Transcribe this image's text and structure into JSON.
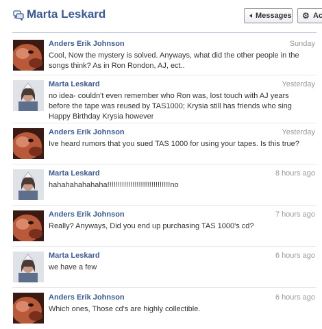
{
  "header": {
    "title": "Marta Leskard",
    "title_icon": "chat-bubbles-icon",
    "messages_button": "Messages",
    "actions_button": "Ac"
  },
  "colors": {
    "link_blue": "#3b5998",
    "timestamp_gray": "#999999",
    "text": "#333333"
  },
  "messages": [
    {
      "sender": "Anders Erik Johnson",
      "time": "Sunday",
      "avatar": "anders-avatar",
      "text": "Cool, Now the mystery is solved. Anyways, what did the other people in the songs think? As in Ron Rondon, AJ, ect.."
    },
    {
      "sender": "Marta Leskard",
      "time": "Yesterday",
      "avatar": "marta-avatar",
      "text": "no idea- couldn't even remember who Ron was, lost touch with AJ years before the tape was reused by TAS1000; Krysia still has friends who sing Happy Birthday Krysia however"
    },
    {
      "sender": "Anders Erik Johnson",
      "time": "Yesterday",
      "avatar": "anders-avatar",
      "text": "Ive heard rumors that you sued TAS 1000 for using your tapes. Is this true?"
    },
    {
      "sender": "Marta Leskard",
      "time": "8 hours ago",
      "avatar": "marta-avatar",
      "text": "hahahahahahaha!!!!!!!!!!!!!!!!!!!!!!!!!!!!!!no"
    },
    {
      "sender": "Anders Erik Johnson",
      "time": "7 hours ago",
      "avatar": "anders-avatar",
      "text": "Really? Anyways, Did you end up purchasing TAS 1000's cd?"
    },
    {
      "sender": "Marta Leskard",
      "time": "6 hours ago",
      "avatar": "marta-avatar",
      "text": "we have a few"
    },
    {
      "sender": "Anders Erik Johnson",
      "time": "6 hours ago",
      "avatar": "anders-avatar",
      "text": "Which ones, Those cd's are highly collectible."
    }
  ]
}
